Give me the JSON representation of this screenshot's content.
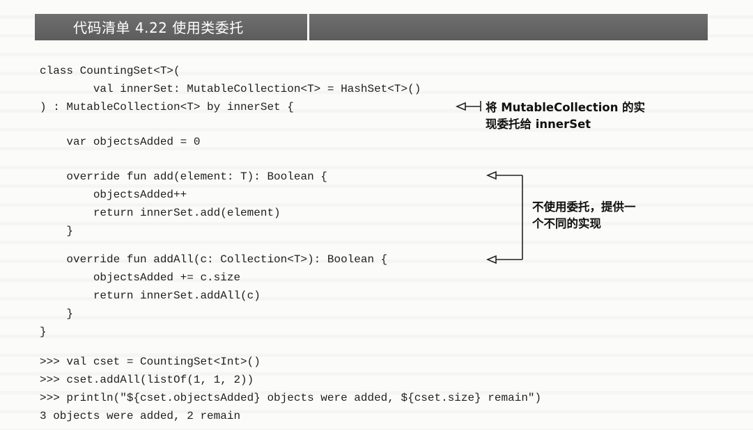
{
  "listing": {
    "title": "代码清单 4.22   使用类委托"
  },
  "code": {
    "lines": [
      "class CountingSet<T>(",
      "        val innerSet: MutableCollection<T> = HashSet<T>()",
      ") : MutableCollection<T> by innerSet {",
      "    var objectsAdded = 0",
      "    override fun add(element: T): Boolean {",
      "        objectsAdded++",
      "        return innerSet.add(element)",
      "    }",
      "    override fun addAll(c: Collection<T>): Boolean {",
      "        objectsAdded += c.size",
      "        return innerSet.addAll(c)",
      "    }",
      "}",
      ">>> val cset = CountingSet<Int>()",
      ">>> cset.addAll(listOf(1, 1, 2))",
      ">>> println(\"${cset.objectsAdded} objects were added, ${cset.size} remain\")",
      "3 objects were added, 2 remain"
    ]
  },
  "annotations": {
    "delegation": {
      "line1": "将 MutableCollection 的实",
      "line2": "现委托给 innerSet"
    },
    "override": {
      "line1": "不使用委托，提供一",
      "line2": "个不同的实现"
    }
  }
}
